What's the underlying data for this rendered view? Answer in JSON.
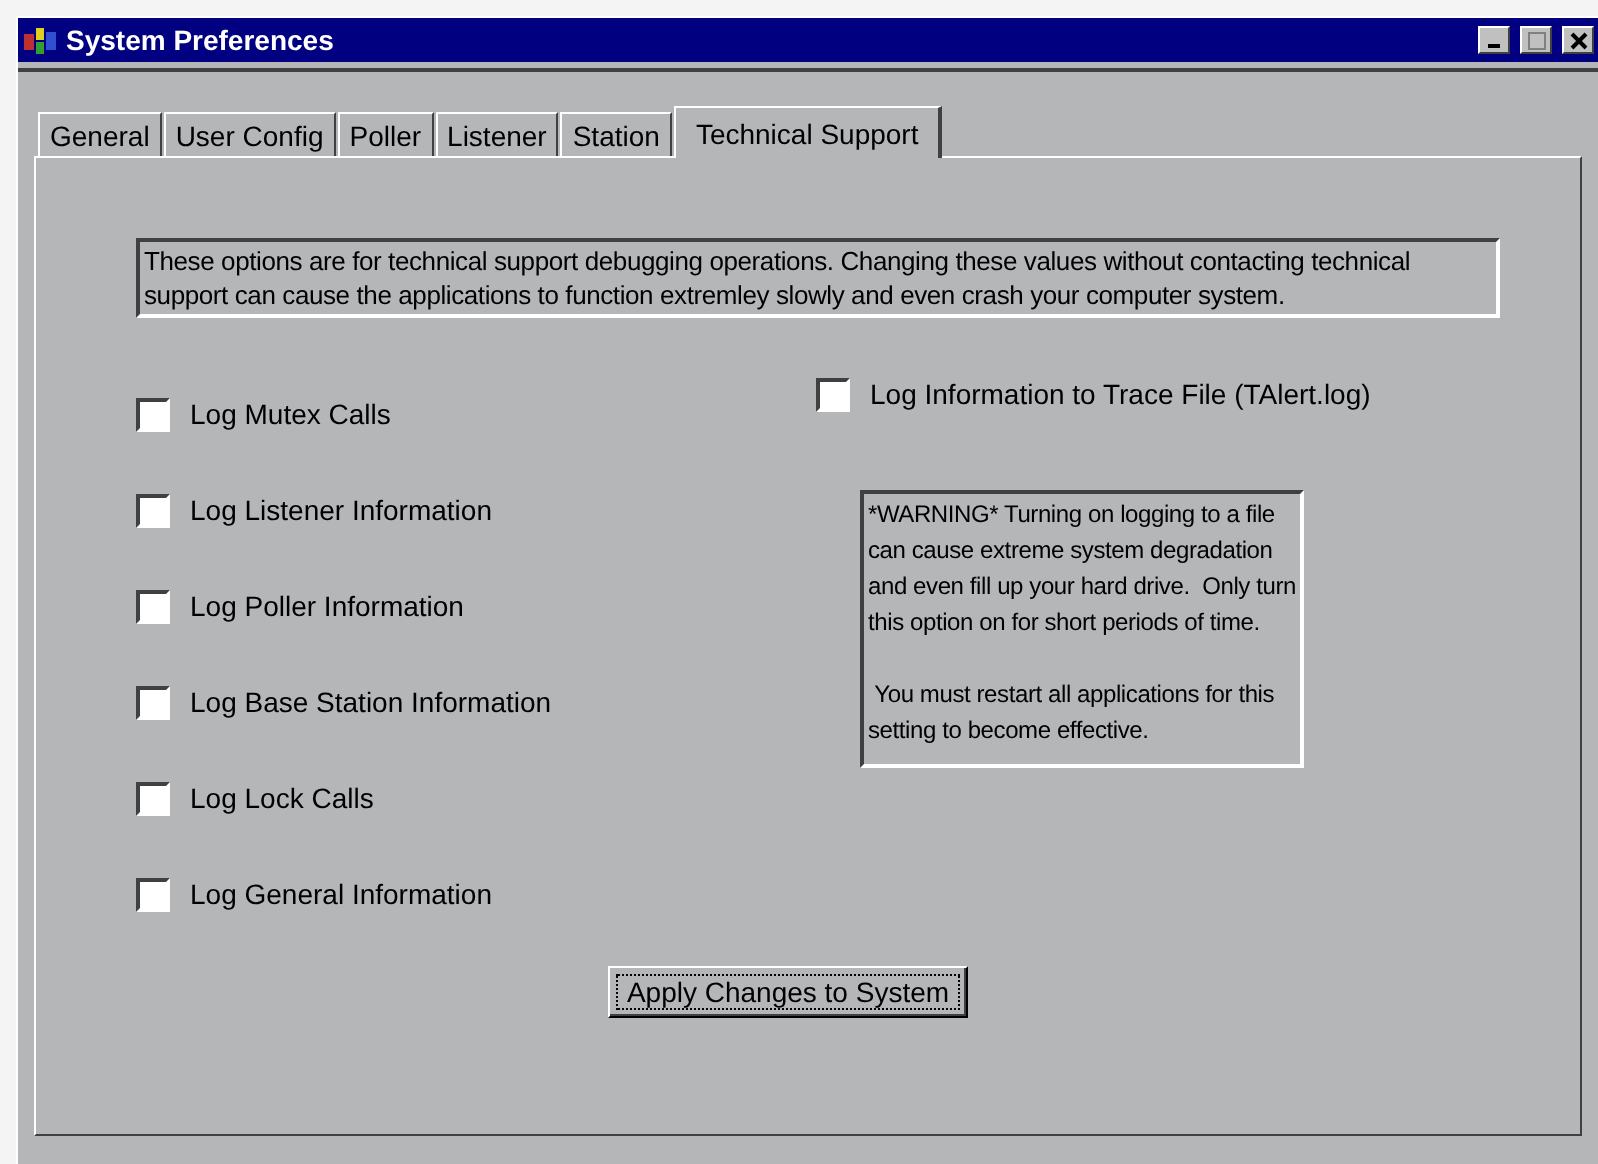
{
  "window": {
    "title": "System Preferences"
  },
  "tabs": [
    {
      "label": "General",
      "selected": false
    },
    {
      "label": "User Config",
      "selected": false
    },
    {
      "label": "Poller",
      "selected": false
    },
    {
      "label": "Listener",
      "selected": false
    },
    {
      "label": "Station",
      "selected": false
    },
    {
      "label": "Technical Support",
      "selected": true
    }
  ],
  "notice": "These options are for technical support debugging operations. Changing these values without contacting technical support can cause the applications to function extremley slowly and even crash your computer system.",
  "options": [
    {
      "label": "Log Mutex Calls",
      "checked": false
    },
    {
      "label": "Log Listener Information",
      "checked": false
    },
    {
      "label": "Log Poller Information",
      "checked": false
    },
    {
      "label": "Log Base Station Information",
      "checked": false
    },
    {
      "label": "Log Lock Calls",
      "checked": false
    },
    {
      "label": "Log General Information",
      "checked": false
    }
  ],
  "trace": {
    "label": "Log Information to Trace File (TAlert.log)",
    "checked": false
  },
  "warning": "*WARNING* Turning on logging to a file can cause extreme system degradation and even fill up your hard drive.  Only turn this option on for short periods of time.\n\n You must restart all applications for this setting to become effective.",
  "apply_button": "Apply Changes to System"
}
